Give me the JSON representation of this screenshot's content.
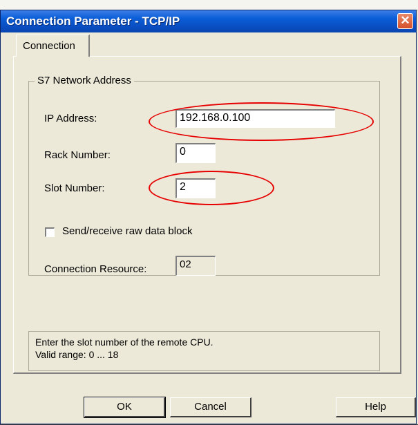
{
  "window": {
    "title": "Connection Parameter - TCP/IP",
    "close_symbol": "✕"
  },
  "tabs": [
    {
      "label": "Connection",
      "selected": true
    }
  ],
  "network_group": {
    "legend": "S7 Network Address",
    "ip_address": {
      "label": "IP Address:",
      "value": "192.168.0.100"
    },
    "rack_number": {
      "label": "Rack Number:",
      "value": "0"
    },
    "slot_number": {
      "label": "Slot Number:",
      "value": "2"
    },
    "raw_data_checkbox": {
      "label": "Send/receive raw data block",
      "checked": false
    },
    "connection_resource": {
      "label": "Connection Resource:",
      "value": "02"
    }
  },
  "info": {
    "line1": "Enter the slot number of the remote CPU.",
    "line2": "Valid range: 0 ... 18"
  },
  "buttons": {
    "ok": "OK",
    "cancel": "Cancel",
    "help": "Help"
  },
  "annotation_color": "#e60000",
  "icons": {
    "close": "close-icon",
    "checkbox": "checkbox-icon"
  }
}
